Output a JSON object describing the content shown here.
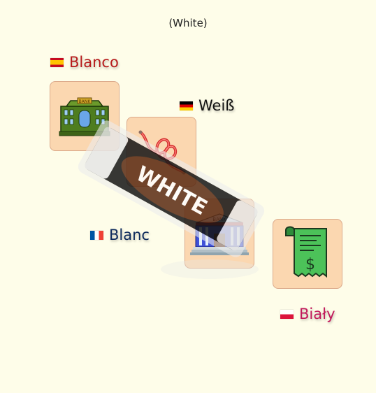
{
  "title": "(White)",
  "labels": {
    "es": {
      "text": "Blanco",
      "color": "#b71c1c",
      "icon": "spain-flag-icon"
    },
    "de": {
      "text": "Weiß",
      "color": "#111111",
      "icon": "germany-flag-icon"
    },
    "fr": {
      "text": "Blanc",
      "color": "#0d2a5c",
      "icon": "france-flag-icon"
    },
    "pl": {
      "text": "Biały",
      "color": "#c2185b",
      "icon": "poland-flag-icon"
    }
  },
  "cards": {
    "bank_green": {
      "icon": "green-bank-icon",
      "sign": "BANK"
    },
    "wire": {
      "icon": "red-wire-icon"
    },
    "bank_blue": {
      "icon": "blue-bank-icon",
      "sign": "BANK"
    },
    "receipt": {
      "icon": "dollar-receipt-icon",
      "symbol": "$"
    }
  },
  "eraser": {
    "text": "WHITE",
    "icon": "white-eraser-icon"
  }
}
